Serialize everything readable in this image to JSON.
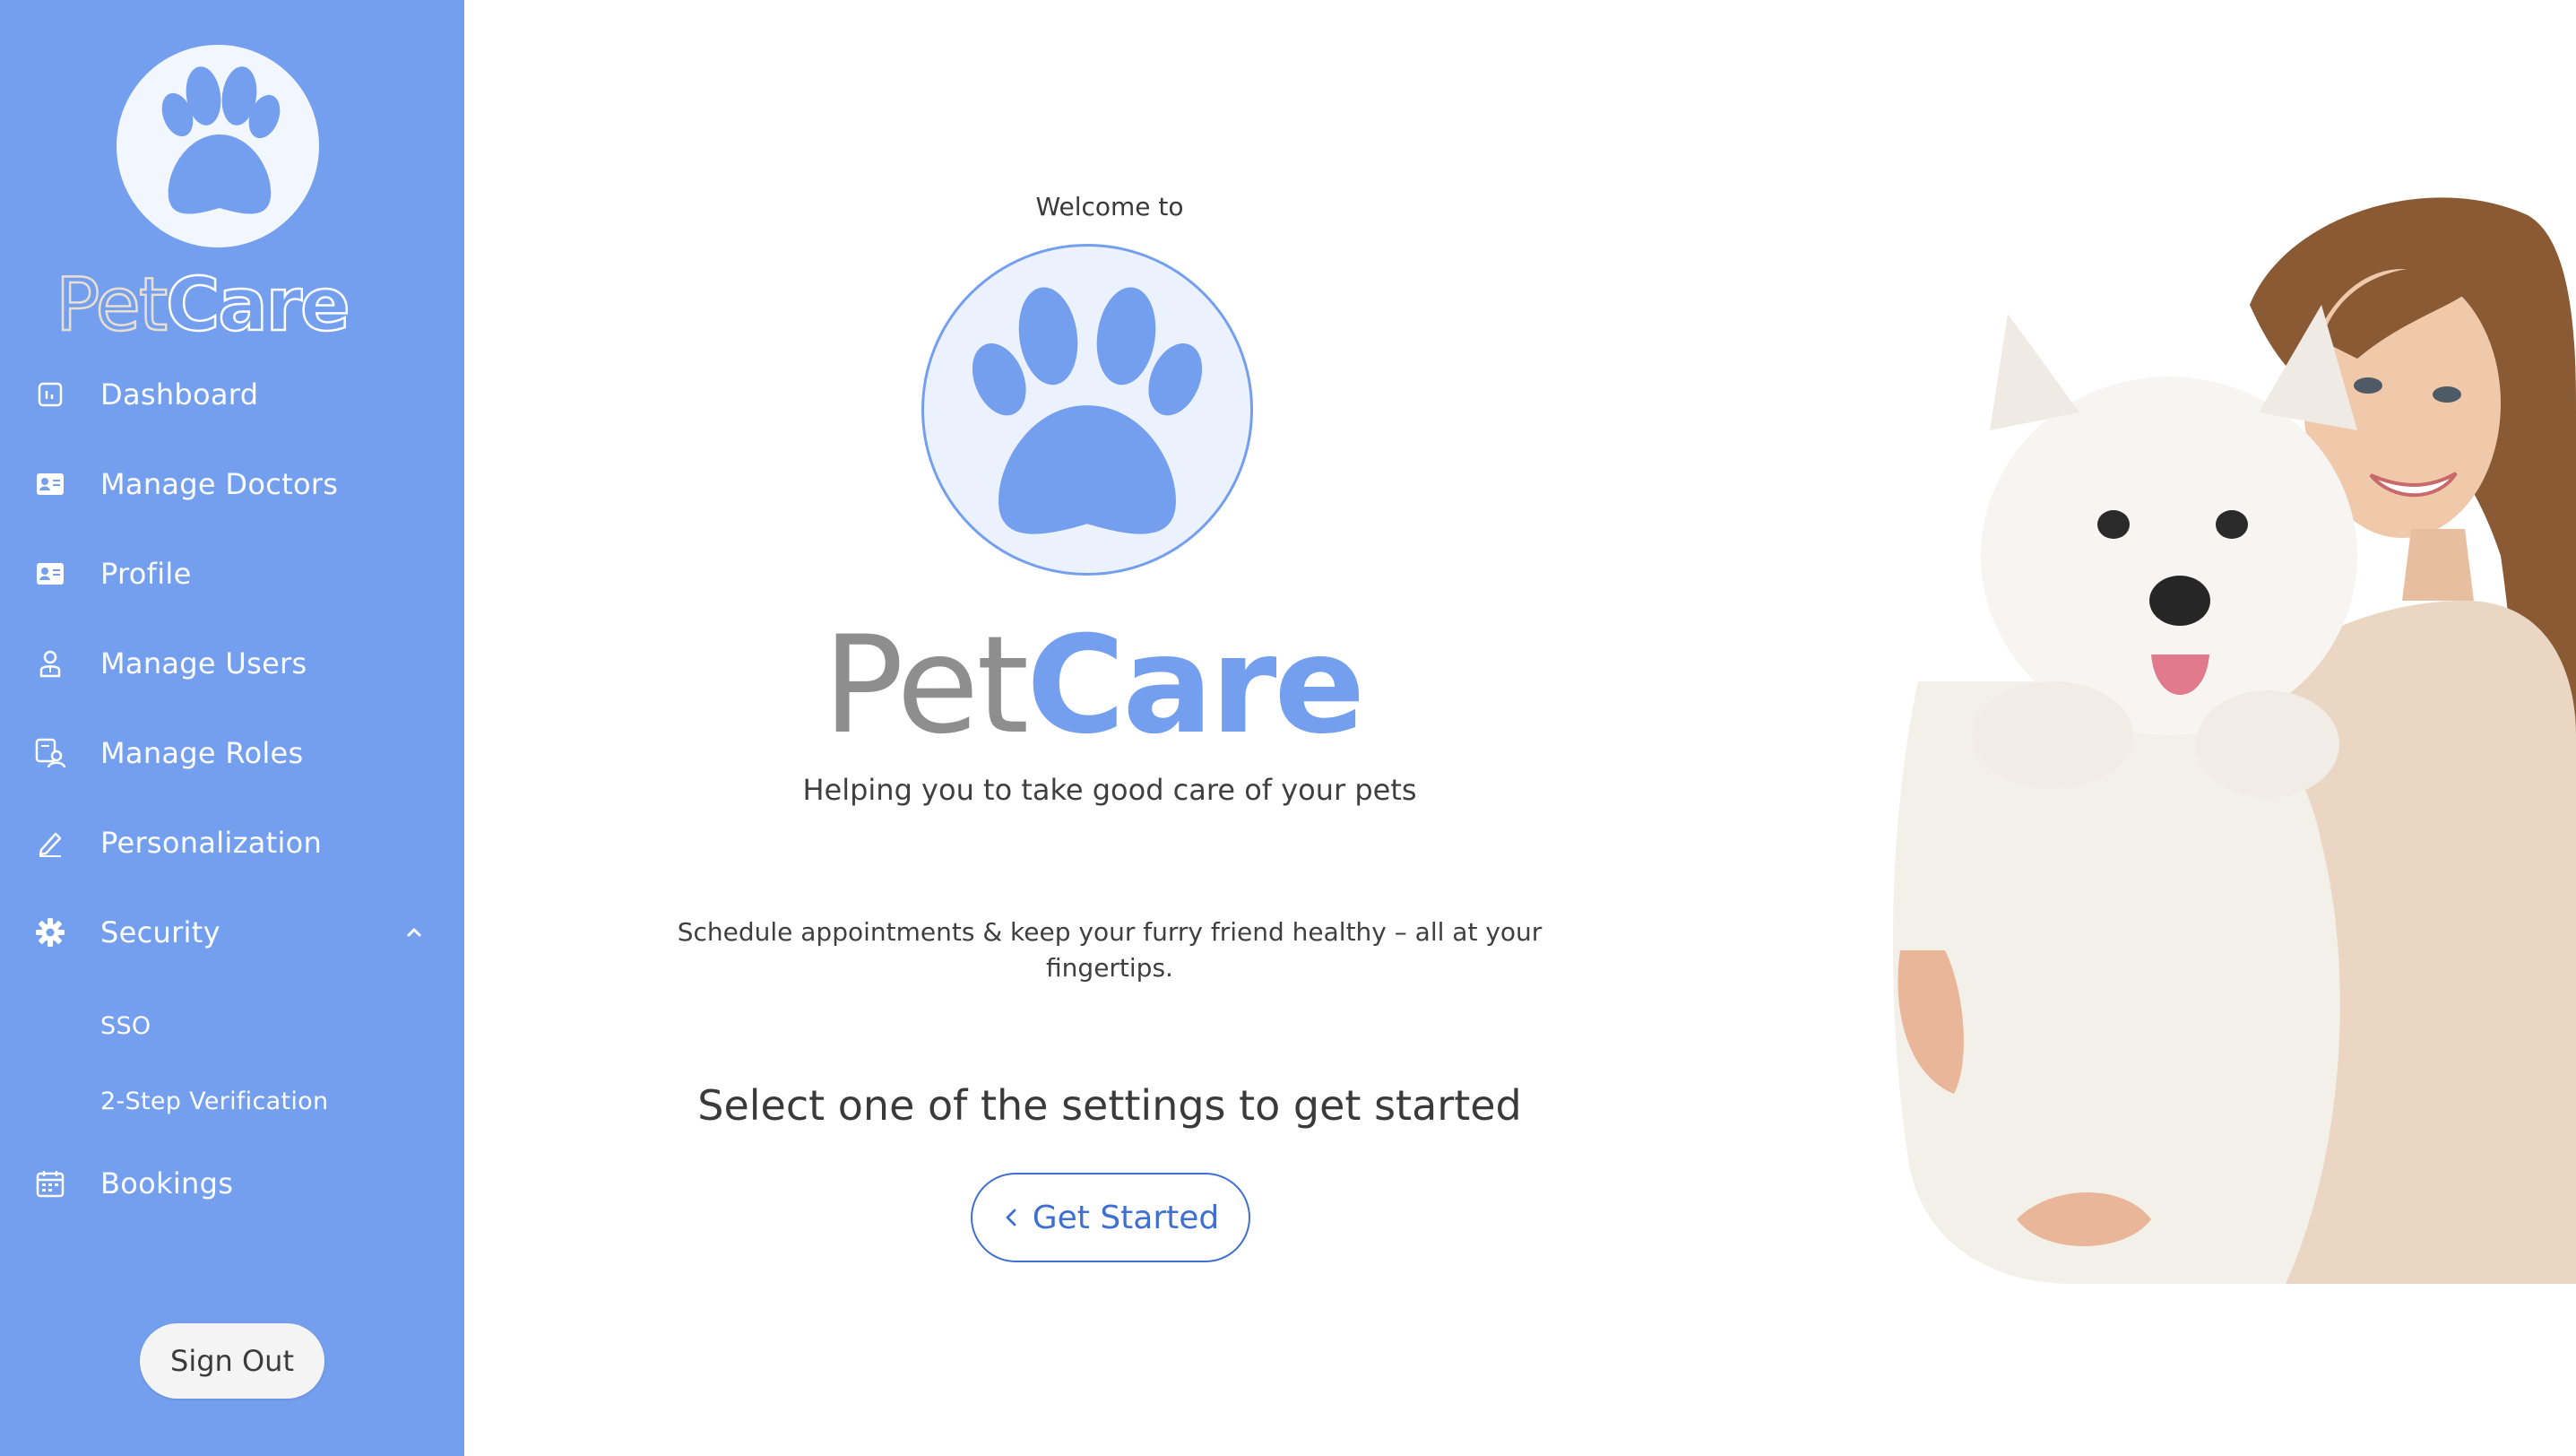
{
  "app": {
    "brand_part1": "Pet",
    "brand_part2": "Care"
  },
  "sidebar": {
    "logo_icon": "paw-icon",
    "items": [
      {
        "label": "Dashboard",
        "icon": "chart-icon"
      },
      {
        "label": "Manage Doctors",
        "icon": "id-card-icon"
      },
      {
        "label": "Profile",
        "icon": "id-card-icon"
      },
      {
        "label": "Manage Users",
        "icon": "user-icon"
      },
      {
        "label": "Manage Roles",
        "icon": "user-roles-icon"
      },
      {
        "label": "Personalization",
        "icon": "pencil-icon"
      },
      {
        "label": "Security",
        "icon": "gear-icon",
        "expanded": true,
        "children": [
          {
            "label": "SSO"
          },
          {
            "label": "2-Step Verification"
          }
        ]
      },
      {
        "label": "Bookings",
        "icon": "calendar-icon"
      }
    ],
    "sign_out_label": "Sign Out"
  },
  "main": {
    "welcome": "Welcome to",
    "tagline": "Helping you to take good care of your pets",
    "description": "Schedule appointments & keep your furry friend healthy – all at your fingertips.",
    "cta_heading": "Select one of the settings to get started",
    "get_started_label": "Get Started"
  },
  "colors": {
    "sidebar_bg": "#749fef",
    "accent": "#749fef",
    "button_border": "#3f6fd1",
    "brand_grey": "#8e8e8e"
  }
}
